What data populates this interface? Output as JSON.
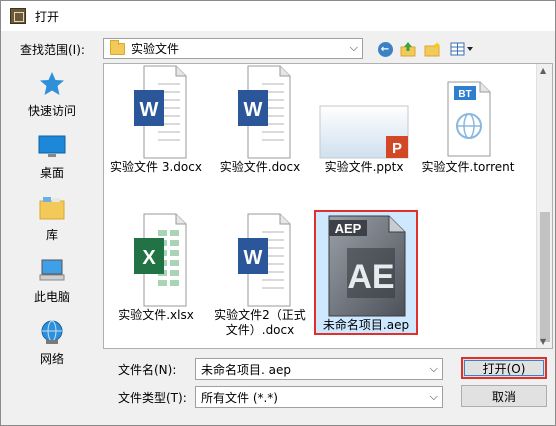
{
  "window": {
    "title": "打开"
  },
  "lookin": {
    "label": "查找范围(I):",
    "value": "实验文件"
  },
  "sidebar": {
    "items": [
      {
        "label": "快速访问",
        "icon": "star-icon"
      },
      {
        "label": "桌面",
        "icon": "desktop-icon"
      },
      {
        "label": "库",
        "icon": "library-icon"
      },
      {
        "label": "此电脑",
        "icon": "computer-icon"
      },
      {
        "label": "网络",
        "icon": "network-icon"
      }
    ]
  },
  "files": [
    {
      "name": "实验文件 3.docx",
      "type": "word",
      "selected": false
    },
    {
      "name": "实验文件.docx",
      "type": "word",
      "selected": false
    },
    {
      "name": "实验文件.pptx",
      "type": "powerpoint",
      "selected": false
    },
    {
      "name": "实验文件.torrent",
      "type": "torrent",
      "selected": false
    },
    {
      "name": "实验文件.xlsx",
      "type": "excel",
      "selected": false
    },
    {
      "name": "实验文件2（正式文件）.docx",
      "type": "word",
      "selected": false
    },
    {
      "name": "未命名项目.aep",
      "type": "aep",
      "selected": true
    }
  ],
  "icon_text": {
    "word": "W",
    "excel": "X",
    "powerpoint": "P",
    "torrent": "BT",
    "aep_banner": "AEP",
    "aep_mark": "AE"
  },
  "filename": {
    "label": "文件名(N):",
    "value": "未命名项目. aep"
  },
  "filetype": {
    "label": "文件类型(T):",
    "value": "所有文件 (*.*)"
  },
  "buttons": {
    "open": "打开(O)",
    "cancel": "取消"
  },
  "colors": {
    "selection_outline": "#e0302c",
    "selection_fill": "#cde8ff",
    "word_blue": "#2b579a",
    "excel_green": "#217346",
    "ppt_orange": "#d24726"
  }
}
